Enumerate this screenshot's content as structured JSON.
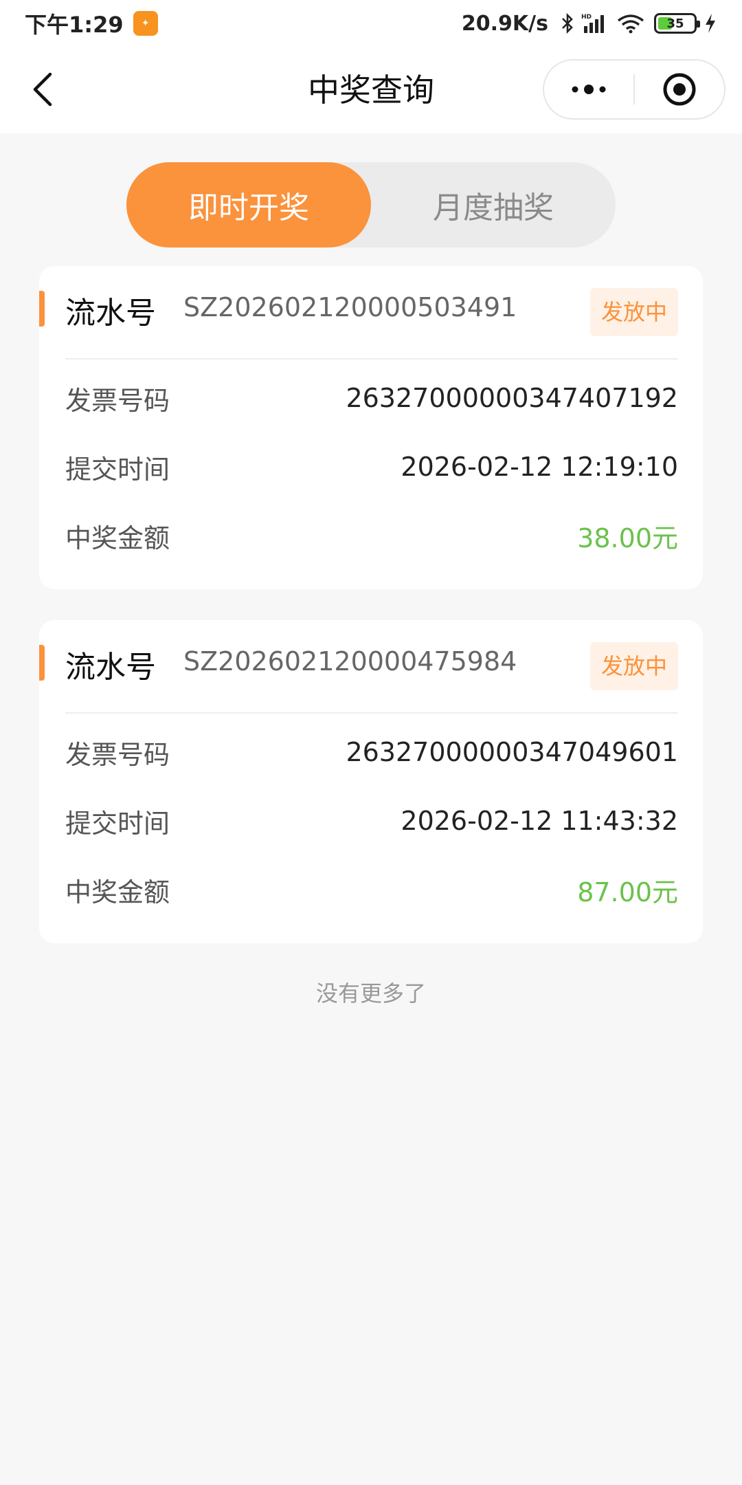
{
  "status_bar": {
    "time": "下午1:29",
    "app_icon": "app-notification-icon",
    "net_speed": "20.9K/s",
    "battery": "35",
    "accent_colors": {
      "battery_fill": "#5ecb3b"
    }
  },
  "nav": {
    "title": "中奖查询",
    "back_icon": "chevron-left-icon",
    "more_icon": "more-dots-icon",
    "close_icon": "target-circle-icon"
  },
  "tabs": [
    {
      "label": "即时开奖",
      "active": true
    },
    {
      "label": "月度抽奖",
      "active": false
    }
  ],
  "records": [
    {
      "serial_label": "流水号",
      "serial_no": "SZ202602120000503491",
      "status": "发放中",
      "fields": [
        {
          "label": "发票号码",
          "value": "26327000000347407192"
        },
        {
          "label": "提交时间",
          "value": "2026-02-12 12:19:10"
        },
        {
          "label": "中奖金额",
          "value": "38.00元"
        }
      ]
    },
    {
      "serial_label": "流水号",
      "serial_no": "SZ202602120000475984",
      "status": "发放中",
      "fields": [
        {
          "label": "发票号码",
          "value": "26327000000347049601"
        },
        {
          "label": "提交时间",
          "value": "2026-02-12 11:43:32"
        },
        {
          "label": "中奖金额",
          "value": "87.00元"
        }
      ]
    }
  ],
  "footer": {
    "note": "没有更多了"
  },
  "colors": {
    "accent": "#fb923c",
    "amount": "#6bc24a",
    "badge_bg": "#fff1e5"
  }
}
